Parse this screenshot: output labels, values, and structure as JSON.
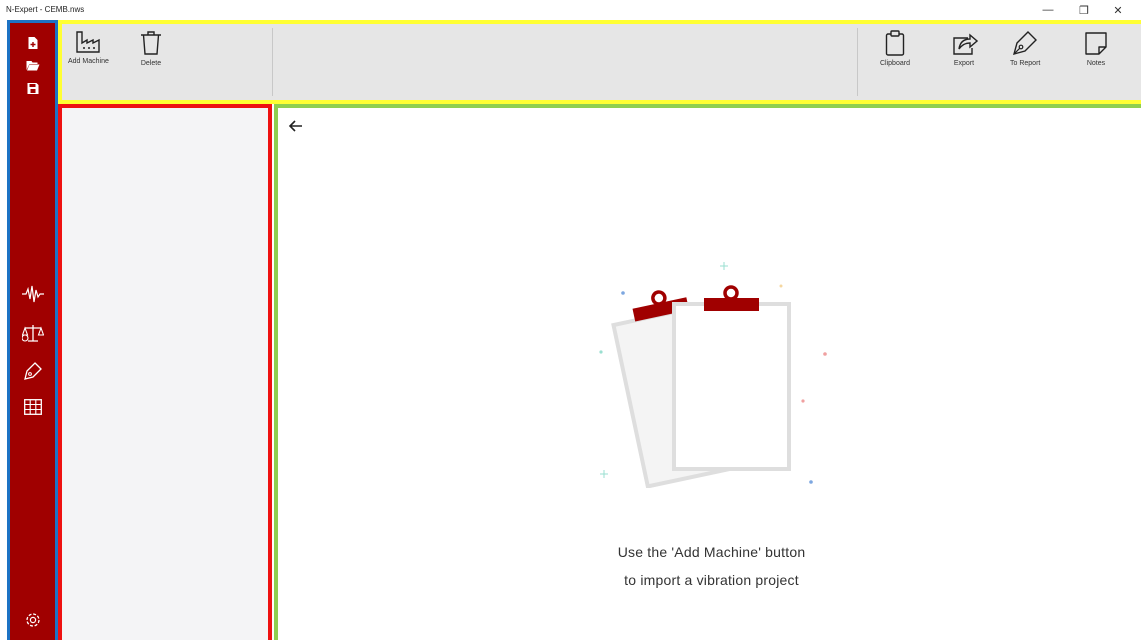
{
  "window": {
    "title": "N-Expert - CEMB.nws",
    "controls": {
      "minimize": "—",
      "restore": "❐",
      "close": "✕"
    }
  },
  "sidebar": {
    "top_icons": [
      "new-file-icon",
      "open-folder-icon",
      "save-icon"
    ],
    "middle_icons": [
      "waveform-icon",
      "balance-icon",
      "pen-icon",
      "table-icon"
    ],
    "bottom_icons": [
      "settings-icon"
    ]
  },
  "toolbar": {
    "add_machine_label": "Add Machine",
    "delete_label": "Delete",
    "clipboard_label": "Clipboard",
    "export_label": "Export",
    "to_report_label": "To Report",
    "notes_label": "Notes"
  },
  "main": {
    "empty_line1": "Use the 'Add Machine' button",
    "empty_line2": "to import a vibration project"
  },
  "colors": {
    "sidebar": "#a00000",
    "sidebar_border": "#1d73c4",
    "toolbar_border": "#ffff33",
    "leftpanel_border": "#ee1111",
    "main_border": "#8fcf4f",
    "clip": "#a00000"
  }
}
